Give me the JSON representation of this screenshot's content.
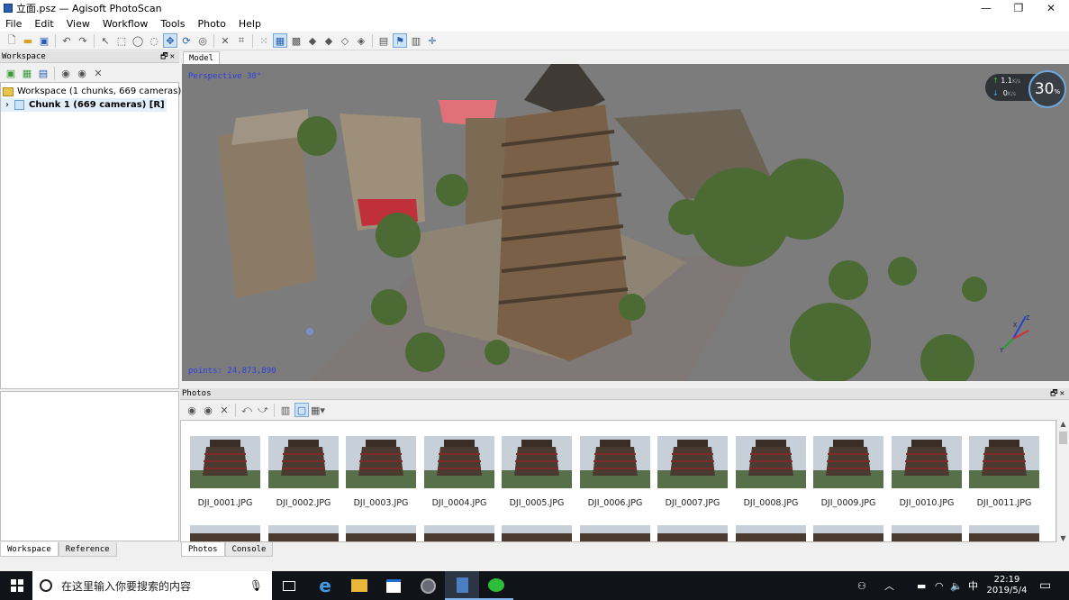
{
  "window": {
    "title": "立面.psz — Agisoft PhotoScan",
    "minimize": "—",
    "restore": "❐",
    "close": "✕"
  },
  "menu": [
    "File",
    "Edit",
    "View",
    "Workflow",
    "Tools",
    "Photo",
    "Help"
  ],
  "workspace": {
    "title": "Workspace",
    "root": "Workspace (1 chunks, 669 cameras)",
    "chunk": "Chunk 1 (669 cameras) [R]",
    "tabs": [
      "Workspace",
      "Reference"
    ]
  },
  "model": {
    "tab": "Model",
    "projection": "Perspective 30°",
    "points": "points: 24,873,890"
  },
  "net": {
    "up": "1.1",
    "down": "0",
    "unit": "K/s",
    "percent": "30",
    "percent_unit": "%"
  },
  "photos": {
    "title": "Photos",
    "tabs": [
      "Photos",
      "Console"
    ],
    "files": [
      "DJI_0001.JPG",
      "DJI_0002.JPG",
      "DJI_0003.JPG",
      "DJI_0004.JPG",
      "DJI_0005.JPG",
      "DJI_0006.JPG",
      "DJI_0007.JPG",
      "DJI_0008.JPG",
      "DJI_0009.JPG",
      "DJI_0010.JPG",
      "DJI_0011.JPG"
    ]
  },
  "taskbar": {
    "search_placeholder": "在这里输入你要搜索的内容",
    "ime": "中",
    "time": "22:19",
    "date": "2019/5/4"
  },
  "colors": {
    "viewport": "#7c7c7c",
    "label": "#2c3fe0",
    "selection": "#cde4f7"
  }
}
